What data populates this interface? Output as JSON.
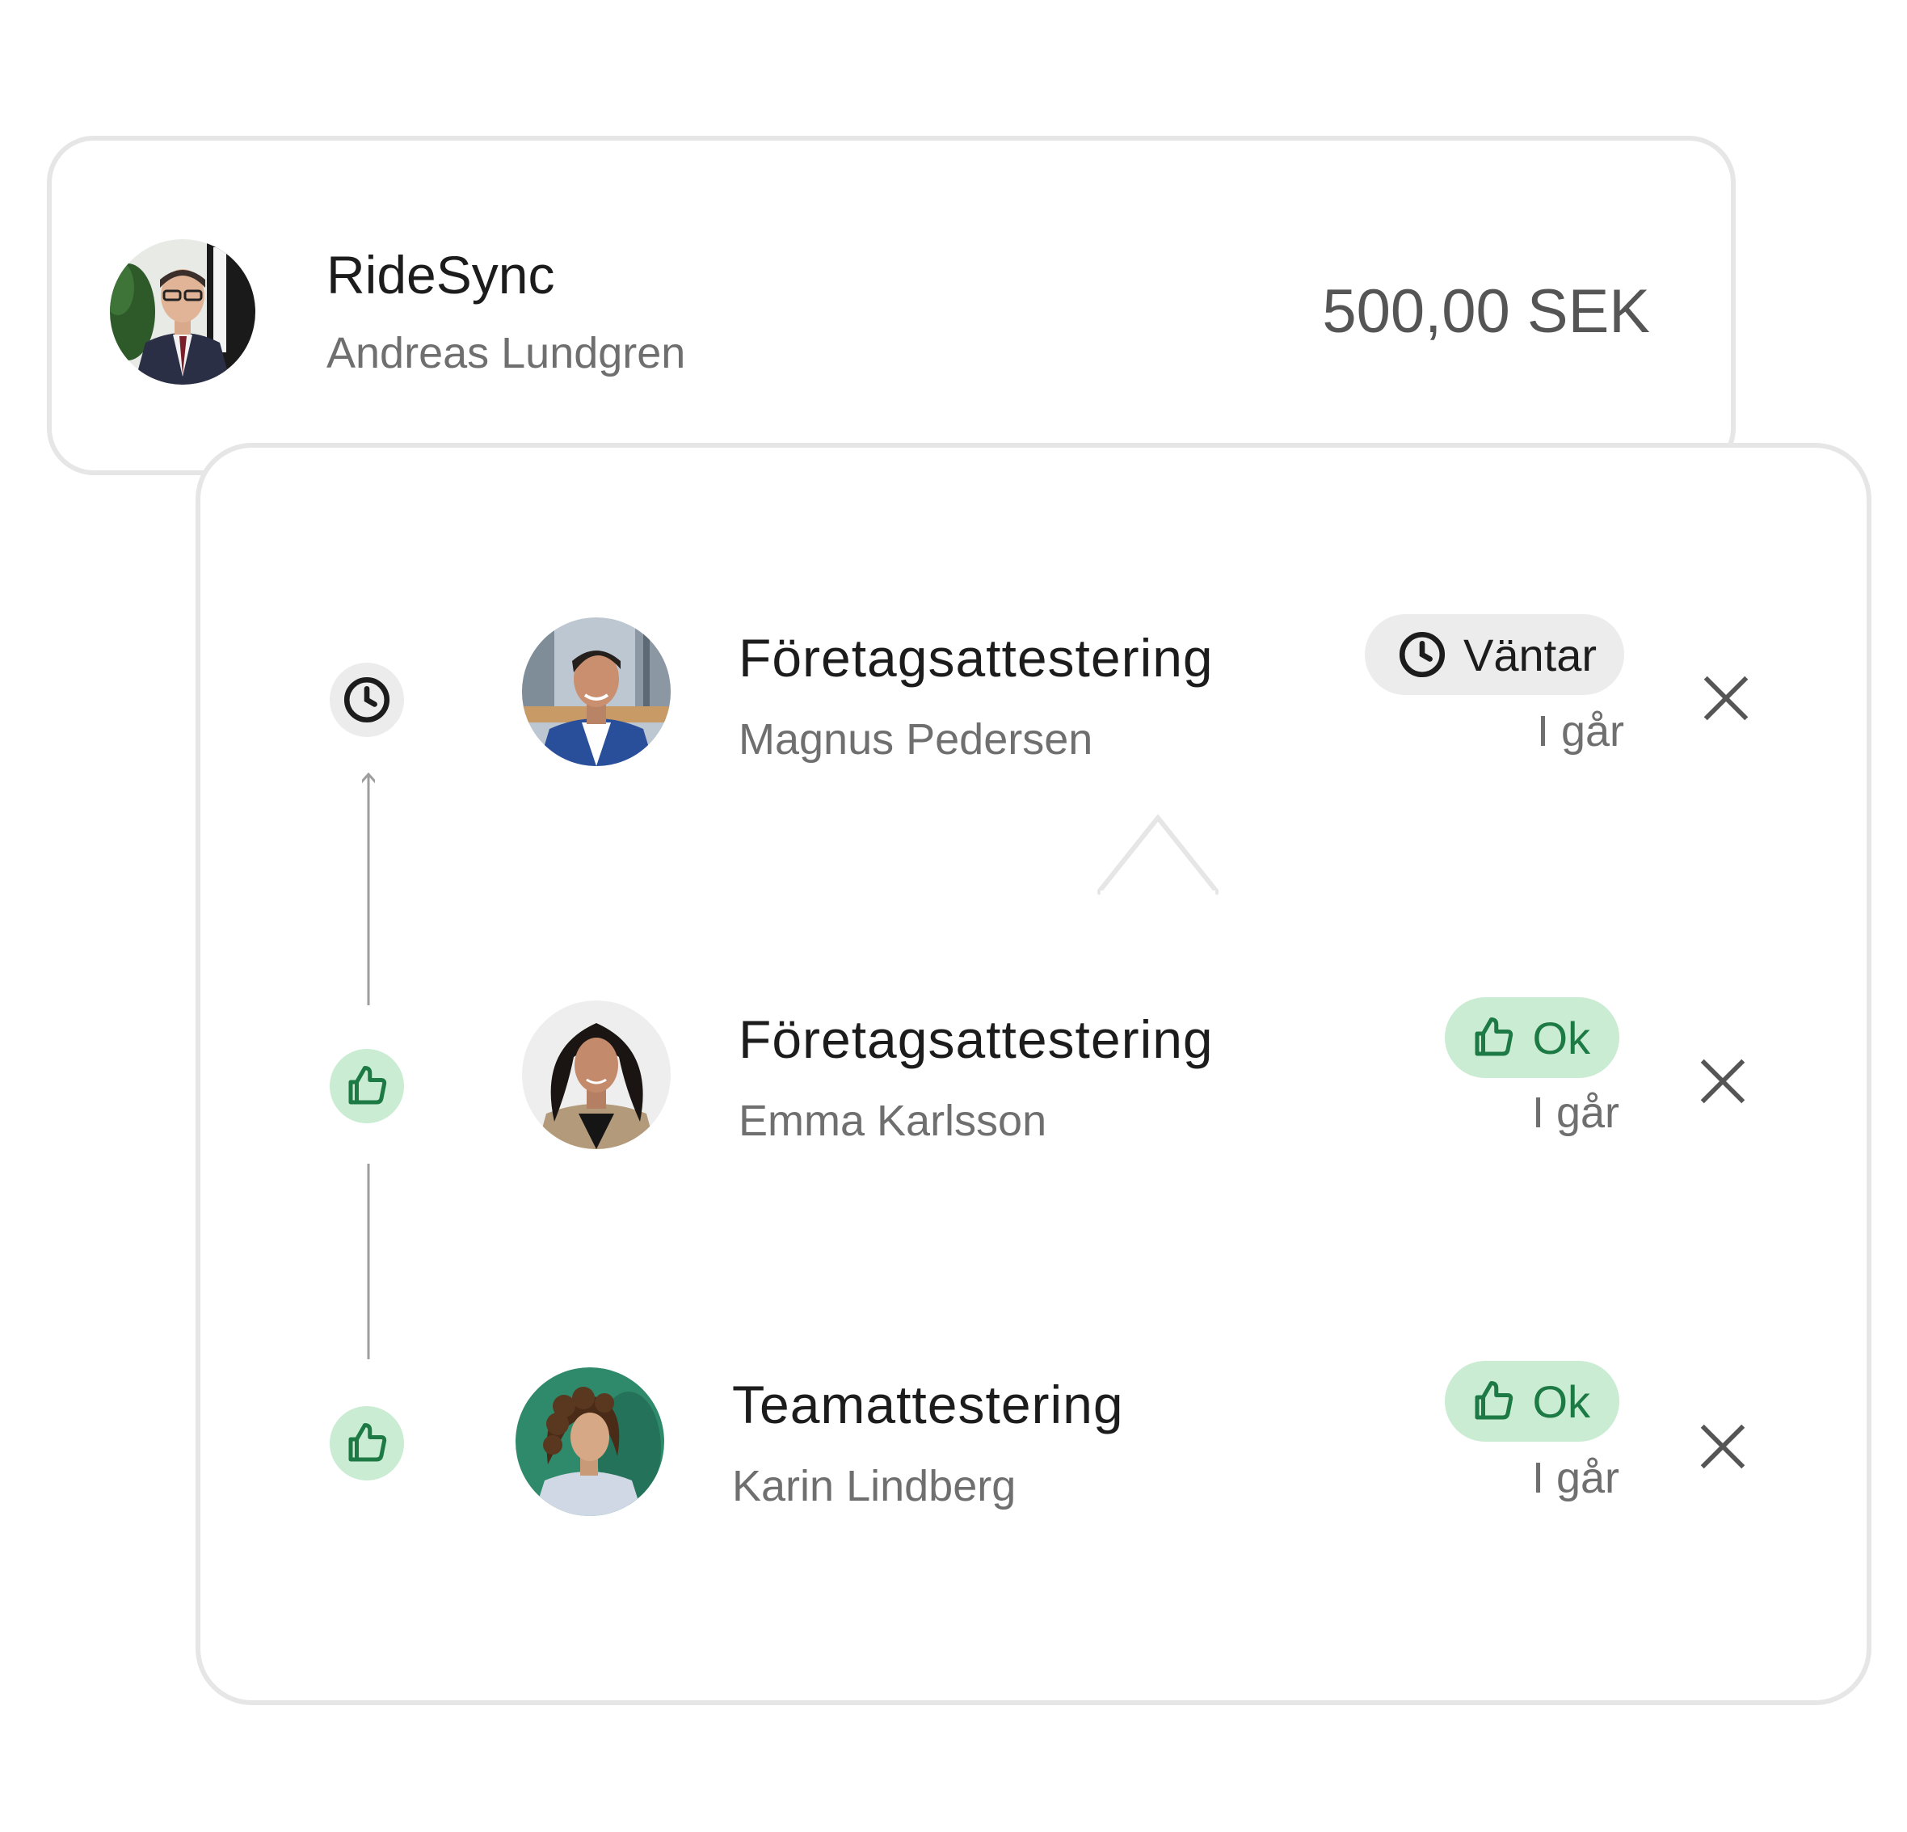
{
  "payee": {
    "merchant": "RideSync",
    "person": "Andreas Lundgren",
    "amount": "500,00 SEK"
  },
  "approvals": [
    {
      "title": "Företagsattestering",
      "approver": "Magnus Pedersen",
      "status": "Väntar",
      "status_type": "pending",
      "status_icon": "clock-icon",
      "time": "I går"
    },
    {
      "title": "Företagsattestering",
      "approver": "Emma Karlsson",
      "status": "Ok",
      "status_type": "ok",
      "status_icon": "thumbs-up-icon",
      "time": "I går"
    },
    {
      "title": "Teamattestering",
      "approver": "Karin Lindberg",
      "status": "Ok",
      "status_type": "ok",
      "status_icon": "thumbs-up-icon",
      "time": "I går"
    }
  ],
  "colors": {
    "card_border": "#e6e6e6",
    "ok_bg": "#c9ecd3",
    "ok_fg": "#1e7a45",
    "pending_bg": "#ececec",
    "text_primary": "#1c1c1c",
    "text_secondary": "#6f6f6f"
  }
}
